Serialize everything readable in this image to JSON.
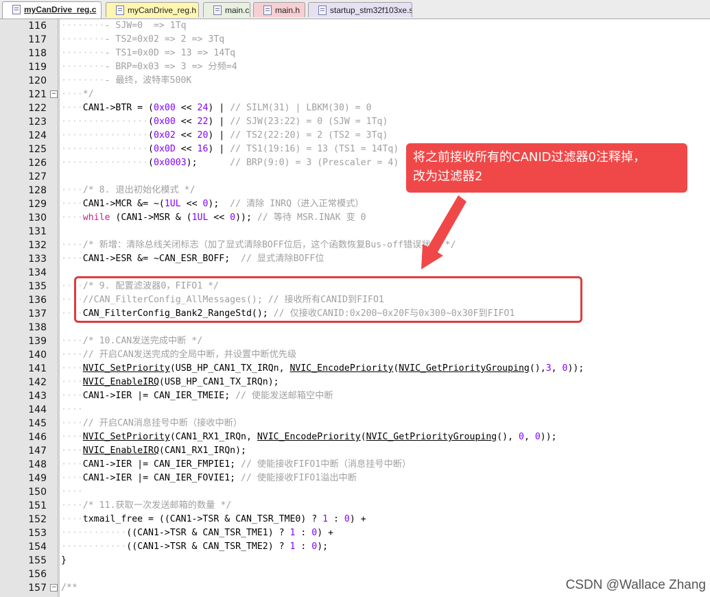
{
  "tabs": [
    {
      "label": "myCanDrive_reg.c",
      "active": true,
      "color": "#ffffff"
    },
    {
      "label": "myCanDrive_reg.h",
      "active": false,
      "color": "#fff6b0"
    },
    {
      "label": "main.c",
      "active": false,
      "color": "#e8f1e0"
    },
    {
      "label": "main.h",
      "active": false,
      "color": "#f6cfd2"
    },
    {
      "label": "startup_stm32f103xe.s",
      "active": false,
      "color": "#e6e0f3"
    }
  ],
  "lines": [
    {
      "no": "116",
      "indent": 8,
      "tokens": [
        {
          "t": "- SJW=0  => 1Tq",
          "c": "c"
        }
      ]
    },
    {
      "no": "117",
      "indent": 8,
      "tokens": [
        {
          "t": "- TS2=0x02 => 2 => 3Tq",
          "c": "c"
        }
      ]
    },
    {
      "no": "118",
      "indent": 8,
      "tokens": [
        {
          "t": "- TS1=0x0D => 13 => 14Tq",
          "c": "c"
        }
      ]
    },
    {
      "no": "119",
      "indent": 8,
      "tokens": [
        {
          "t": "- BRP=0x03 => 3 => 分频=4",
          "c": "c"
        }
      ]
    },
    {
      "no": "120",
      "indent": 8,
      "tokens": [
        {
          "t": "- 最终，波特率500K",
          "c": "c"
        }
      ]
    },
    {
      "no": "121",
      "indent": 4,
      "fold": "-",
      "tokens": [
        {
          "t": "*/",
          "c": "c"
        }
      ]
    },
    {
      "no": "122",
      "indent": 4,
      "tokens": [
        {
          "t": "CAN1->BTR = ",
          "c": "o"
        },
        {
          "t": "(",
          "c": "o"
        },
        {
          "t": "0x00",
          "c": "n"
        },
        {
          "t": " << ",
          "c": "o"
        },
        {
          "t": "24",
          "c": "n"
        },
        {
          "t": ") | ",
          "c": "o"
        },
        {
          "t": "// SILM(31) | LBKM(30) = 0",
          "c": "c"
        }
      ]
    },
    {
      "no": "123",
      "indent": 16,
      "tokens": [
        {
          "t": "(",
          "c": "o"
        },
        {
          "t": "0x00",
          "c": "n"
        },
        {
          "t": " << ",
          "c": "o"
        },
        {
          "t": "22",
          "c": "n"
        },
        {
          "t": ") | ",
          "c": "o"
        },
        {
          "t": "// SJW(23:22) = 0 (SJW = 1Tq)",
          "c": "c"
        }
      ]
    },
    {
      "no": "124",
      "indent": 16,
      "tokens": [
        {
          "t": "(",
          "c": "o"
        },
        {
          "t": "0x02",
          "c": "n"
        },
        {
          "t": " << ",
          "c": "o"
        },
        {
          "t": "20",
          "c": "n"
        },
        {
          "t": ") | ",
          "c": "o"
        },
        {
          "t": "// TS2(22:20) = 2 (TS2 = 3Tq)",
          "c": "c"
        }
      ]
    },
    {
      "no": "125",
      "indent": 16,
      "tokens": [
        {
          "t": "(",
          "c": "o"
        },
        {
          "t": "0x0D",
          "c": "n"
        },
        {
          "t": " << ",
          "c": "o"
        },
        {
          "t": "16",
          "c": "n"
        },
        {
          "t": ") | ",
          "c": "o"
        },
        {
          "t": "// TS1(19:16) = 13 (TS1 = 14Tq)",
          "c": "c"
        }
      ]
    },
    {
      "no": "126",
      "indent": 16,
      "tokens": [
        {
          "t": "(",
          "c": "o"
        },
        {
          "t": "0x0003",
          "c": "n"
        },
        {
          "t": ");      ",
          "c": "o"
        },
        {
          "t": "// BRP(9:0) = 3 (Prescaler = 4)",
          "c": "c"
        }
      ]
    },
    {
      "no": "127",
      "indent": 0,
      "tokens": []
    },
    {
      "no": "128",
      "indent": 4,
      "tokens": [
        {
          "t": "/* 8. 退出初始化模式 */",
          "c": "c"
        }
      ]
    },
    {
      "no": "129",
      "indent": 4,
      "tokens": [
        {
          "t": "CAN1->MCR &= ~(",
          "c": "o"
        },
        {
          "t": "1UL",
          "c": "n"
        },
        {
          "t": " << ",
          "c": "o"
        },
        {
          "t": "0",
          "c": "n"
        },
        {
          "t": ");  ",
          "c": "o"
        },
        {
          "t": "// 清除 INRQ（进入正常模式）",
          "c": "c"
        }
      ]
    },
    {
      "no": "130",
      "indent": 4,
      "tokens": [
        {
          "t": "while",
          "c": "k"
        },
        {
          "t": " (CAN1->MSR & (",
          "c": "o"
        },
        {
          "t": "1UL",
          "c": "n"
        },
        {
          "t": " << ",
          "c": "o"
        },
        {
          "t": "0",
          "c": "n"
        },
        {
          "t": ")); ",
          "c": "o"
        },
        {
          "t": "// 等待 MSR.INAK 变 0",
          "c": "c"
        }
      ]
    },
    {
      "no": "131",
      "indent": 0,
      "tokens": []
    },
    {
      "no": "132",
      "indent": 4,
      "tokens": [
        {
          "t": "/* 新增：清除总线关闭标志（加了显式清除BOFF位后，这个函数恢复Bus-off错误状态 */",
          "c": "c"
        }
      ]
    },
    {
      "no": "133",
      "indent": 4,
      "tokens": [
        {
          "t": "CAN1->ESR &= ~CAN_ESR_BOFF;  ",
          "c": "o"
        },
        {
          "t": "// 显式清除BOFF位",
          "c": "c"
        }
      ]
    },
    {
      "no": "134",
      "indent": 0,
      "tokens": []
    },
    {
      "no": "135",
      "indent": 4,
      "tokens": [
        {
          "t": "/* 9. 配置滤波器0，FIFO1 */",
          "c": "c"
        }
      ]
    },
    {
      "no": "136",
      "indent": 4,
      "tokens": [
        {
          "t": "//CAN_FilterConfig_AllMessages(); // 接收所有CANID到FIFO1",
          "c": "c"
        }
      ]
    },
    {
      "no": "137",
      "indent": 4,
      "tokens": [
        {
          "t": "CAN_FilterConfig_Bank2_RangeStd",
          "c": "o"
        },
        {
          "t": "(); ",
          "c": "o"
        },
        {
          "t": "// 仅接收CANID:0x200~0x20F与0x300~0x30F到FIFO1",
          "c": "c"
        }
      ]
    },
    {
      "no": "138",
      "indent": 0,
      "tokens": []
    },
    {
      "no": "139",
      "indent": 4,
      "tokens": [
        {
          "t": "/* 10.CAN发送完成中断 */",
          "c": "c"
        }
      ]
    },
    {
      "no": "140",
      "indent": 4,
      "tokens": [
        {
          "t": "// 开启CAN发送完成的全局中断，并设置中断优先级",
          "c": "c"
        }
      ]
    },
    {
      "no": "141",
      "indent": 4,
      "tokens": [
        {
          "t": "NVIC_SetPriority",
          "c": "f"
        },
        {
          "t": "(USB_HP_CAN1_TX_IRQn, ",
          "c": "o"
        },
        {
          "t": "NVIC_EncodePriority",
          "c": "f"
        },
        {
          "t": "(",
          "c": "o"
        },
        {
          "t": "NVIC_GetPriorityGrouping",
          "c": "f"
        },
        {
          "t": "(),",
          "c": "o"
        },
        {
          "t": "3",
          "c": "n"
        },
        {
          "t": ", ",
          "c": "o"
        },
        {
          "t": "0",
          "c": "n"
        },
        {
          "t": "));",
          "c": "o"
        }
      ]
    },
    {
      "no": "142",
      "indent": 4,
      "tokens": [
        {
          "t": "NVIC_EnableIRQ",
          "c": "f"
        },
        {
          "t": "(USB_HP_CAN1_TX_IRQn);",
          "c": "o"
        }
      ]
    },
    {
      "no": "143",
      "indent": 4,
      "tokens": [
        {
          "t": "CAN1->IER |= CAN_IER_TMEIE; ",
          "c": "o"
        },
        {
          "t": "// 使能发送邮箱空中断",
          "c": "c"
        }
      ]
    },
    {
      "no": "144",
      "indent": 4,
      "tokens": []
    },
    {
      "no": "145",
      "indent": 4,
      "tokens": [
        {
          "t": "// 开启CAN消息挂号中断（接收中断）",
          "c": "c"
        }
      ]
    },
    {
      "no": "146",
      "indent": 4,
      "tokens": [
        {
          "t": "NVIC_SetPriority",
          "c": "f"
        },
        {
          "t": "(CAN1_RX1_IRQn, ",
          "c": "o"
        },
        {
          "t": "NVIC_EncodePriority",
          "c": "f"
        },
        {
          "t": "(",
          "c": "o"
        },
        {
          "t": "NVIC_GetPriorityGrouping",
          "c": "f"
        },
        {
          "t": "(), ",
          "c": "o"
        },
        {
          "t": "0",
          "c": "n"
        },
        {
          "t": ", ",
          "c": "o"
        },
        {
          "t": "0",
          "c": "n"
        },
        {
          "t": "));",
          "c": "o"
        }
      ]
    },
    {
      "no": "147",
      "indent": 4,
      "tokens": [
        {
          "t": "NVIC_EnableIRQ",
          "c": "f"
        },
        {
          "t": "(CAN1_RX1_IRQn);",
          "c": "o"
        }
      ]
    },
    {
      "no": "148",
      "indent": 4,
      "tokens": [
        {
          "t": "CAN1->IER |= CAN_IER_FMPIE1; ",
          "c": "o"
        },
        {
          "t": "// 使能接收FIFO1中断（消息挂号中断）",
          "c": "c"
        }
      ]
    },
    {
      "no": "149",
      "indent": 4,
      "tokens": [
        {
          "t": "CAN1->IER |= CAN_IER_FOVIE1; ",
          "c": "o"
        },
        {
          "t": "// 使能接收FIFO1溢出中断",
          "c": "c"
        }
      ]
    },
    {
      "no": "150",
      "indent": 4,
      "tokens": []
    },
    {
      "no": "151",
      "indent": 4,
      "tokens": [
        {
          "t": "/* 11.获取一次发送邮箱的数量 */",
          "c": "c"
        }
      ]
    },
    {
      "no": "152",
      "indent": 4,
      "tokens": [
        {
          "t": "txmail_free = ((CAN1->TSR & CAN_TSR_TME0) ? ",
          "c": "o"
        },
        {
          "t": "1",
          "c": "n"
        },
        {
          "t": " : ",
          "c": "o"
        },
        {
          "t": "0",
          "c": "n"
        },
        {
          "t": ") +",
          "c": "o"
        }
      ]
    },
    {
      "no": "153",
      "indent": 12,
      "tokens": [
        {
          "t": "((CAN1->TSR & CAN_TSR_TME1) ? ",
          "c": "o"
        },
        {
          "t": "1",
          "c": "n"
        },
        {
          "t": " : ",
          "c": "o"
        },
        {
          "t": "0",
          "c": "n"
        },
        {
          "t": ") +",
          "c": "o"
        }
      ]
    },
    {
      "no": "154",
      "indent": 12,
      "tokens": [
        {
          "t": "((CAN1->TSR & CAN_TSR_TME2) ? ",
          "c": "o"
        },
        {
          "t": "1",
          "c": "n"
        },
        {
          "t": " : ",
          "c": "o"
        },
        {
          "t": "0",
          "c": "n"
        },
        {
          "t": ");",
          "c": "o"
        }
      ]
    },
    {
      "no": "155",
      "indent": 0,
      "tokens": [
        {
          "t": "}",
          "c": "o"
        }
      ]
    },
    {
      "no": "156",
      "indent": 0,
      "tokens": []
    },
    {
      "no": "157",
      "indent": 0,
      "fold": "-",
      "tokens": [
        {
          "t": "/**",
          "c": "c"
        }
      ]
    }
  ],
  "annotation": {
    "callout_line1": "将之前接收所有的CANID过滤器0注释掉，",
    "callout_line2": "改为过滤器2",
    "callout_color": "#f04848",
    "box_color": "#e03b3b"
  },
  "watermark": "CSDN @Wallace Zhang"
}
